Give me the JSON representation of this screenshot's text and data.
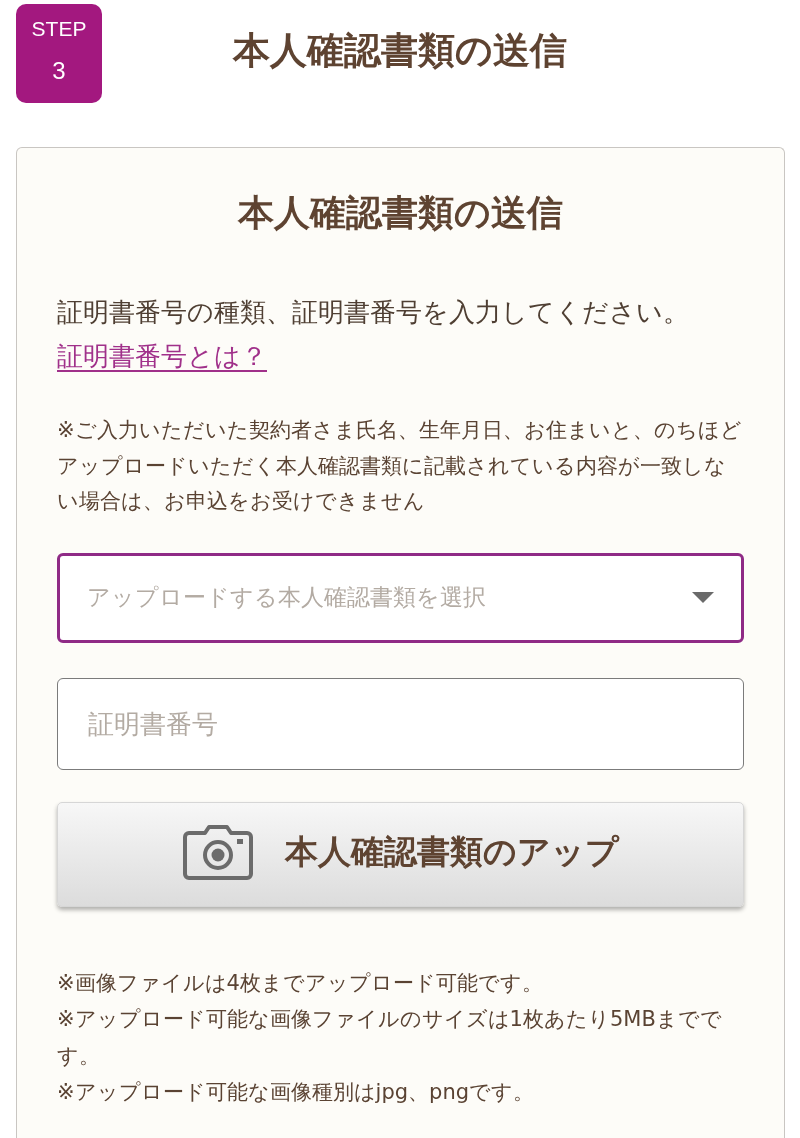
{
  "step_badge": {
    "label": "STEP",
    "number": "3"
  },
  "header": {
    "title": "本人確認書類の送信"
  },
  "card": {
    "title": "本人確認書類の送信",
    "instruction": "証明書番号の種類、証明書番号を入力してください。",
    "help_link": "証明書番号とは？",
    "notice": "※ご入力いただいた契約者さま氏名、生年月日、お住まいと、のちほどアップロードいただく本人確認書類に記載されている内容が一致しない場合は、お申込をお受けできません",
    "document_select": {
      "placeholder": "アップロードする本人確認書類を選択",
      "focused": true
    },
    "number_field": {
      "placeholder": "証明書番号",
      "focused": false
    },
    "upload_button": {
      "label": "本人確認書類のアップ"
    },
    "notes": [
      "※画像ファイルは4枚までアップロード可能です。",
      "※アップロード可能な画像ファイルのサイズは1枚あたり5MBまでです。",
      "※アップロード可能な画像種別はjpg、pngです。"
    ]
  }
}
